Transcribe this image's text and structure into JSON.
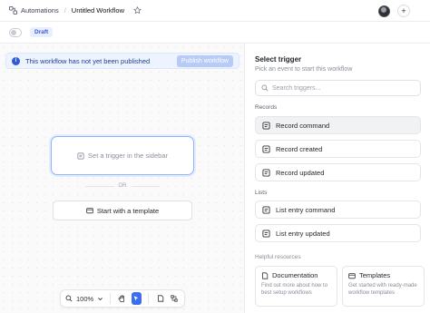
{
  "topbar": {
    "breadcrumb_root": "Automations",
    "breadcrumb_current": "Untitled Workflow"
  },
  "subbar": {
    "status_badge": "Draft"
  },
  "canvas": {
    "notice_text": "This workflow has not yet been published",
    "publish_label": "Publish workflow",
    "trigger_placeholder": "Set a trigger in the sidebar",
    "or_label": "OR",
    "template_label": "Start with a template",
    "zoom": "100%"
  },
  "sidebar": {
    "title": "Select trigger",
    "subtitle": "Pick an event to start this workflow",
    "search_placeholder": "Search triggers...",
    "groups": [
      {
        "label": "Records",
        "items": [
          {
            "label": "Record command"
          },
          {
            "label": "Record created"
          },
          {
            "label": "Record updated"
          }
        ]
      },
      {
        "label": "Lists",
        "items": [
          {
            "label": "List entry command"
          },
          {
            "label": "List entry updated"
          }
        ]
      }
    ],
    "resources_label": "Helpful resources",
    "resources": [
      {
        "title": "Documentation",
        "desc": "Find out more about how to best setup workflows"
      },
      {
        "title": "Templates",
        "desc": "Get started with ready-made workflow templates"
      }
    ]
  },
  "colors": {
    "accent": "#3b6ff0",
    "notice_bg": "#edf3ff",
    "publish_bg": "#b7cbf6"
  }
}
